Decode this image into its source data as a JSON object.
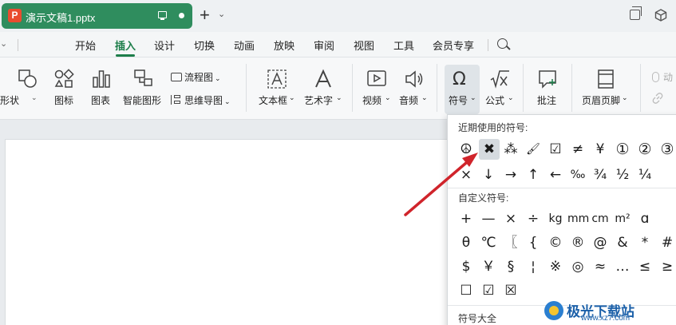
{
  "titlebar": {
    "doc_logo_letter": "P",
    "doc_name": "演示文稿1.pptx",
    "new_tab_plus": "+",
    "new_tab_chevron": "⌄"
  },
  "menubar": {
    "items": [
      "开始",
      "插入",
      "设计",
      "切换",
      "动画",
      "放映",
      "审阅",
      "视图",
      "工具",
      "会员专享"
    ],
    "active": "插入",
    "left_chevron": "⌄"
  },
  "ribbon": {
    "partial_left": "形状",
    "icon_label": "图标",
    "chart_label": "图表",
    "smartart_label": "智能图形",
    "flowchart_label": "流程图",
    "mindmap_label": "思维导图",
    "textbox_label": "文本框",
    "wordart_label": "艺术字",
    "video_label": "视频",
    "audio_label": "音频",
    "symbol_label": "符号",
    "formula_label": "公式",
    "comment_label": "批注",
    "headerfooter_label": "页眉页脚",
    "partial_right_top": "动",
    "dropdown_marker": "⌄"
  },
  "symbol_panel": {
    "recent_header": "近期使用的符号:",
    "recent_row1": [
      "☮",
      "✖",
      "⁂",
      "🖌",
      "☑",
      "≠",
      "¥",
      "①",
      "②",
      "③"
    ],
    "recent_row2": [
      "×",
      "↓",
      "→",
      "↑",
      "←",
      "‰",
      "¾",
      "½",
      "¼"
    ],
    "custom_header": "自定义符号:",
    "custom_row1": [
      "+",
      "—",
      "×",
      "÷",
      "kg",
      "mm",
      "cm",
      "m²",
      "ɑ"
    ],
    "custom_row2": [
      "θ",
      "℃",
      "〖",
      "{",
      "©",
      "®",
      "@",
      "&",
      "*",
      "#"
    ],
    "custom_row3": [
      "$",
      "￥",
      "§",
      "¦",
      "※",
      "◎",
      "≈",
      "…",
      "≤",
      "≥"
    ],
    "custom_row4": [
      "☐",
      "☑",
      "☒"
    ],
    "all_header": "符号大全"
  },
  "watermark": {
    "title": "极光下载站",
    "url": "www.xz7.com"
  },
  "colors": {
    "accent_green": "#2f8d5e",
    "arrow_red": "#d0242b",
    "watermark_blue": "#1a5fa8"
  }
}
